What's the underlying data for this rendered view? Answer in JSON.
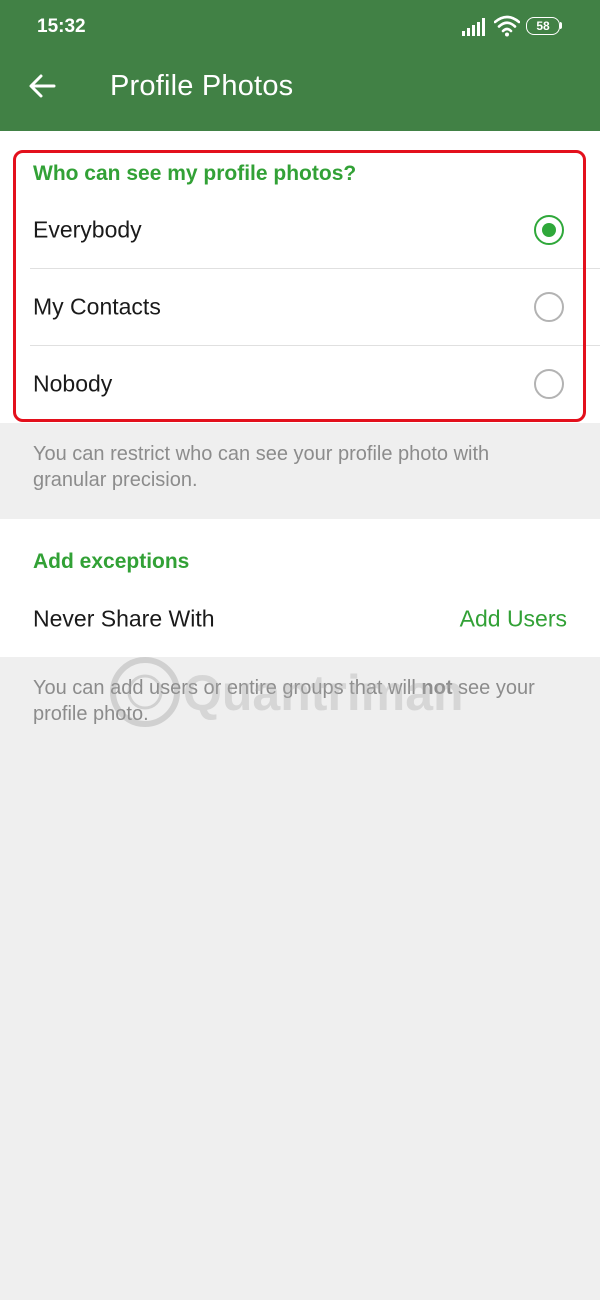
{
  "status_bar": {
    "time": "15:32",
    "battery": "58"
  },
  "app_bar": {
    "title": "Profile Photos"
  },
  "privacy": {
    "header": "Who can see my profile photos?",
    "options": [
      {
        "label": "Everybody",
        "selected": true
      },
      {
        "label": "My Contacts",
        "selected": false
      },
      {
        "label": "Nobody",
        "selected": false
      }
    ],
    "hint": "You can restrict who can see your profile photo with granular precision."
  },
  "exceptions": {
    "header": "Add exceptions",
    "never_share_label": "Never Share With",
    "add_users_label": "Add Users",
    "hint_before": "You can add users or entire groups that will ",
    "hint_bold": "not",
    "hint_after": " see your profile photo."
  },
  "watermark": {
    "text": "Quantrimang"
  },
  "colors": {
    "app_bar": "#418145",
    "accent": "#32a136",
    "highlight": "#e3101c",
    "background": "#efefef"
  },
  "icons": {
    "back": "arrow-left-icon",
    "signal": "signal-icon",
    "wifi": "wifi-icon",
    "battery": "battery-icon"
  }
}
